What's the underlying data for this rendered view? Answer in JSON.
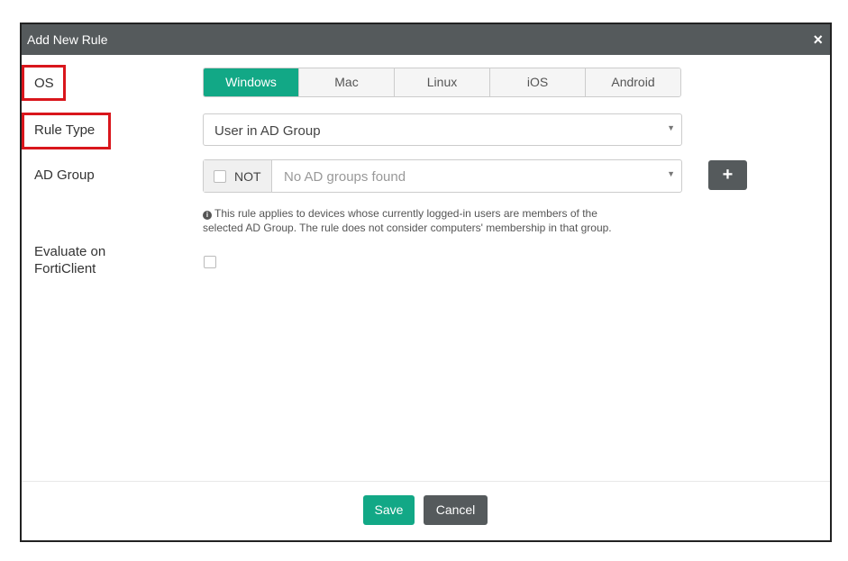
{
  "dialog": {
    "title": "Add New Rule",
    "close_glyph": "×"
  },
  "form": {
    "os_label": "OS",
    "rule_type_label": "Rule Type",
    "ad_group_label": "AD Group",
    "evaluate_label_line1": "Evaluate on",
    "evaluate_label_line2": "FortiClient"
  },
  "os_options": [
    "Windows",
    "Mac",
    "Linux",
    "iOS",
    "Android"
  ],
  "os_selected": "Windows",
  "rule_type": {
    "value": "User in AD Group"
  },
  "ad_group": {
    "not_label": "NOT",
    "placeholder": "No AD groups found",
    "add_glyph": "+"
  },
  "info_text_line1": "This rule applies to devices whose currently logged-in users are members of the",
  "info_text_line2": "selected AD Group. The rule does not consider computers' membership in that group.",
  "buttons": {
    "save": "Save",
    "cancel": "Cancel"
  },
  "colors": {
    "accent": "#12a886",
    "titlebar": "#555a5c",
    "highlight": "#d9161c"
  }
}
